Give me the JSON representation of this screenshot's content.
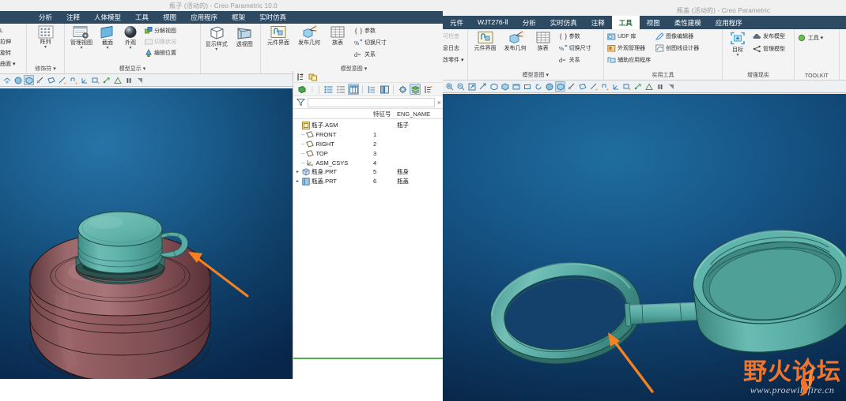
{
  "left_window": {
    "title": "瓶子 (活动的) - Creo Parametric 10.0",
    "tabs": [
      {
        "label": "分析",
        "active": false
      },
      {
        "label": "注释",
        "active": false
      },
      {
        "label": "人体模型",
        "active": false
      },
      {
        "label": "工具",
        "active": false
      },
      {
        "label": "视图",
        "active": false
      },
      {
        "label": "应用程序",
        "active": false
      },
      {
        "label": "框架",
        "active": false
      },
      {
        "label": "实时仿真",
        "active": false
      }
    ],
    "ribbon_groups": [
      {
        "title": "曲面 ▾",
        "clipped": true,
        "small_buttons": [
          {
            "label": "L",
            "icon": "generic-icon"
          },
          {
            "label": "拉伸",
            "icon": "extrude-icon"
          },
          {
            "label": "旋转",
            "icon": "revolve-icon"
          },
          {
            "label": "曲面 ▾",
            "icon": "surface-icon"
          }
        ]
      },
      {
        "title": "修饰符 ▾",
        "big_buttons": [
          {
            "label": "阵列",
            "icon": "pattern-icon",
            "caret": "▾"
          }
        ]
      },
      {
        "title": "模型显示 ▾",
        "big_buttons": [
          {
            "label": "管理视图",
            "icon": "manage-views-icon",
            "caret": "▾"
          },
          {
            "label": "截面",
            "icon": "section-icon",
            "caret": "▾"
          },
          {
            "label": "外观",
            "icon": "appearance-icon",
            "caret": "▾"
          }
        ],
        "small_buttons": [
          {
            "label": "分解视图",
            "icon": "explode-view-icon",
            "disabled": false
          },
          {
            "label": "切换状况",
            "icon": "toggle-status-icon",
            "disabled": true
          },
          {
            "label": "编辑位置",
            "icon": "edit-position-icon",
            "disabled": false
          }
        ]
      },
      {
        "title": "",
        "big_buttons": [
          {
            "label": "显示样式",
            "icon": "display-style-icon",
            "caret": "▾"
          },
          {
            "label": "透视图",
            "icon": "perspective-view-icon",
            "caret": ""
          }
        ]
      },
      {
        "title": "模型意图 ▾",
        "big_buttons": [
          {
            "label": "元件界面",
            "icon": "component-interface-icon",
            "caret": ""
          },
          {
            "label": "发布几何",
            "icon": "publish-geometry-icon",
            "caret": ""
          },
          {
            "label": "族表",
            "icon": "family-table-icon",
            "caret": ""
          }
        ],
        "small_buttons": [
          {
            "label": "参数",
            "icon": "parameters-icon"
          },
          {
            "label": "切换尺寸",
            "icon": "switch-dimensions-icon"
          },
          {
            "label": "关系",
            "icon": "relations-icon"
          }
        ]
      }
    ],
    "graphics_toolbar": [
      {
        "icon": "repaint-icon",
        "active": false
      },
      {
        "icon": "shade-icon",
        "active": false
      },
      {
        "icon": "display-style-icon",
        "active": true
      },
      {
        "icon": "no-hidden-icon",
        "active": false
      },
      {
        "icon": "datum-plane-icon",
        "active": false
      },
      {
        "icon": "datum-axis-icon",
        "active": false
      },
      {
        "icon": "datum-point-icon",
        "active": false
      },
      {
        "icon": "datum-csys-icon",
        "active": false
      },
      {
        "icon": "annotation-display-icon",
        "active": false
      },
      {
        "icon": "spin-center-icon",
        "active": false
      },
      {
        "icon": "warning-icon",
        "active": false
      },
      {
        "icon": "pause-icon",
        "active": false
      },
      {
        "icon": "stop-icon",
        "active": false
      }
    ],
    "viewport": {
      "model_name": "瓶子",
      "arrow_color": "#f58220",
      "background_top": "#1b5886",
      "background_bottom": "#0c2d4e",
      "body_color": "#8b5a5e",
      "cap_color": "#64b3ac"
    }
  },
  "tree_panel": {
    "top_toolbar_icons": [
      {
        "icon": "tree-settings-icon"
      },
      {
        "icon": "tree-columns-icon"
      }
    ],
    "toolbar_icons": [
      {
        "icon": "tree-filter-green-icon",
        "active": false
      },
      {
        "icon": "list-view-icon",
        "active": false
      },
      {
        "icon": "list-dots-icon",
        "active": false
      },
      {
        "icon": "columns-view-icon",
        "active": true
      },
      {
        "icon": "tree-expand-icon",
        "active": false
      },
      {
        "icon": "tree-collapse-icon",
        "active": false
      },
      {
        "icon": "settings-gear-icon",
        "active": false
      },
      {
        "icon": "layers-icon",
        "active": true
      },
      {
        "icon": "tree-filters-icon",
        "active": false
      }
    ],
    "filter": {
      "icon": "funnel-icon",
      "value": "",
      "placeholder": "",
      "close_label": "×"
    },
    "columns": [
      "",
      "特征号",
      "ENG_NAME"
    ],
    "rows": [
      {
        "icon": "assembly-icon",
        "label": "瓶子.ASM",
        "indent": 0,
        "expander": "",
        "num": "",
        "eng": "瓶子"
      },
      {
        "icon": "datum-plane-icon",
        "label": "FRONT",
        "indent": 1,
        "expander": "–",
        "num": "1",
        "eng": ""
      },
      {
        "icon": "datum-plane-icon",
        "label": "RIGHT",
        "indent": 1,
        "expander": "–",
        "num": "2",
        "eng": ""
      },
      {
        "icon": "datum-plane-icon",
        "label": "TOP",
        "indent": 1,
        "expander": "–",
        "num": "3",
        "eng": ""
      },
      {
        "icon": "datum-csys-icon",
        "label": "ASM_CSYS",
        "indent": 1,
        "expander": "–",
        "num": "4",
        "eng": ""
      },
      {
        "icon": "part-icon",
        "label": "瓶身.PRT",
        "indent": 1,
        "expander": "▸",
        "num": "5",
        "eng": "瓶身"
      },
      {
        "icon": "part-blue-icon",
        "label": "瓶盖.PRT",
        "indent": 1,
        "expander": "▸",
        "num": "6",
        "eng": "瓶盖"
      }
    ]
  },
  "right_window": {
    "title": "瓶盖 (活动的) - Creo Parametric",
    "tabs": [
      {
        "label": "元件",
        "active": false
      },
      {
        "label": "WJT276-Ⅱ",
        "active": false
      },
      {
        "label": "分析",
        "active": false
      },
      {
        "label": "实时仿真",
        "active": false
      },
      {
        "label": "注释",
        "active": false
      },
      {
        "label": "工具",
        "active": true
      },
      {
        "label": "视图",
        "active": false
      },
      {
        "label": "柔性建模",
        "active": false
      },
      {
        "label": "应用程序",
        "active": false
      }
    ],
    "ribbon_groups": [
      {
        "title": "",
        "clipped": true,
        "small_buttons": [
          {
            "label": "可检查",
            "icon": "inspect-icon",
            "disabled": true
          },
          {
            "label": "息日志",
            "icon": "message-log-icon",
            "disabled": false
          },
          {
            "label": "改零件 ▾",
            "icon": "modified-parts-icon",
            "disabled": false
          }
        ]
      },
      {
        "title": "模型意图 ▾",
        "big_buttons": [
          {
            "label": "元件界面",
            "icon": "component-interface-icon",
            "caret": ""
          },
          {
            "label": "发布几何",
            "icon": "publish-geometry-icon",
            "caret": ""
          },
          {
            "label": "族表",
            "icon": "family-table-icon",
            "caret": ""
          }
        ],
        "small_buttons": [
          {
            "label": "参数",
            "icon": "parameters-icon"
          },
          {
            "label": "切换尺寸",
            "icon": "switch-dimensions-icon"
          },
          {
            "label": "关系",
            "icon": "relations-icon"
          }
        ]
      },
      {
        "title": "实用工具",
        "small_buttons": [
          {
            "label": "UDF 库",
            "icon": "udf-library-icon"
          },
          {
            "label": "外观管理器",
            "icon": "appearance-manager-icon"
          },
          {
            "label": "辅助应用程序",
            "icon": "auxiliary-apps-icon"
          }
        ],
        "small_buttons2": [
          {
            "label": "图像编辑器",
            "icon": "image-editor-icon"
          },
          {
            "label": "创图线设计器",
            "icon": "curve-designer-icon"
          }
        ]
      },
      {
        "title": "增强现实",
        "big_buttons": [
          {
            "label": "目标",
            "icon": "ar-target-icon",
            "caret": "▾"
          }
        ],
        "small_buttons": [
          {
            "label": "发布模型",
            "icon": "publish-model-icon"
          },
          {
            "label": "管理模型",
            "icon": "manage-model-icon"
          }
        ]
      },
      {
        "title": "TOOLKIT",
        "small_buttons": [
          {
            "label": "工具 ▾",
            "icon": "toolkit-icon"
          }
        ]
      }
    ],
    "graphics_toolbar": [
      {
        "icon": "zoom-in-icon",
        "active": false
      },
      {
        "icon": "zoom-out-icon",
        "active": false
      },
      {
        "icon": "refit-icon",
        "active": false
      },
      {
        "icon": "perspective-icon",
        "active": false
      },
      {
        "icon": "standard-orient-icon",
        "active": false
      },
      {
        "icon": "saved-views-icon",
        "active": false
      },
      {
        "icon": "view-manager-icon",
        "active": false
      },
      {
        "icon": "named-view-icon",
        "active": false
      },
      {
        "icon": "spin-icon",
        "active": false
      },
      {
        "icon": "shade-icon",
        "active": false
      },
      {
        "icon": "display-style-icon",
        "active": true
      },
      {
        "icon": "no-hidden-icon",
        "active": false
      },
      {
        "icon": "datum-plane-icon",
        "active": false
      },
      {
        "icon": "datum-axis-icon",
        "active": false
      },
      {
        "icon": "datum-point-icon",
        "active": false
      },
      {
        "icon": "datum-csys-icon",
        "active": false
      },
      {
        "icon": "annotation-display-icon",
        "active": false
      },
      {
        "icon": "spin-center-icon",
        "active": false
      },
      {
        "icon": "warning-icon",
        "active": false
      },
      {
        "icon": "pause-icon",
        "active": false
      },
      {
        "icon": "stop-icon",
        "active": false
      }
    ],
    "viewport": {
      "model_name": "瓶盖",
      "arrow_color": "#f58220",
      "cap_color": "#4f9e99"
    }
  },
  "watermark": {
    "text_cn": "野火论坛",
    "url": "www.proewildfire.cn",
    "flame_color": "#f0742a"
  }
}
